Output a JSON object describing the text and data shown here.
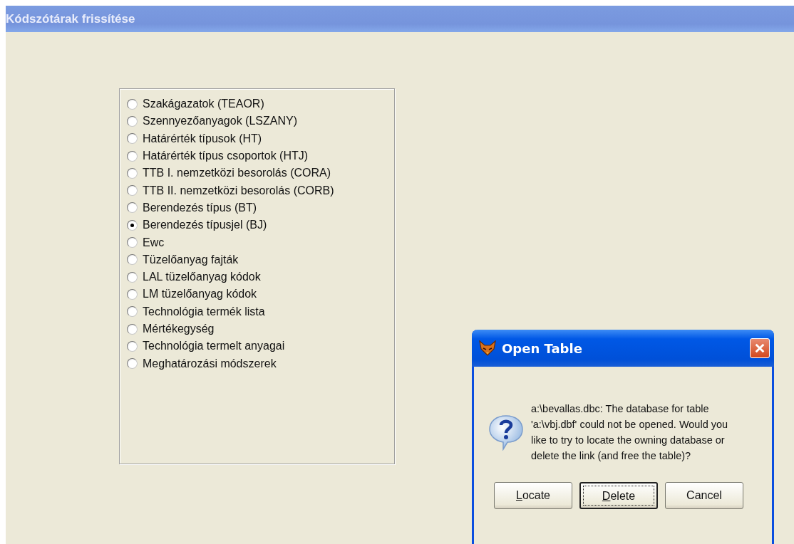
{
  "window": {
    "title": "Kódszótárak frissítése"
  },
  "options": [
    {
      "label": "Szakágazatok (TEAOR)",
      "selected": false
    },
    {
      "label": "Szennyezőanyagok (LSZANY)",
      "selected": false
    },
    {
      "label": "Határérték típusok (HT)",
      "selected": false
    },
    {
      "label": "Határérték típus csoportok (HTJ)",
      "selected": false
    },
    {
      "label": "TTB I. nemzetközi besorolás (CORA)",
      "selected": false
    },
    {
      "label": "TTB II. nemzetközi besorolás (CORB)",
      "selected": false
    },
    {
      "label": "Berendezés típus (BT)",
      "selected": false
    },
    {
      "label": "Berendezés típusjel (BJ)",
      "selected": true
    },
    {
      "label": "Ewc",
      "selected": false
    },
    {
      "label": "Tüzelőanyag fajták",
      "selected": false
    },
    {
      "label": "LAL tüzelőanyag kódok",
      "selected": false
    },
    {
      "label": "LM tüzelőanyag kódok",
      "selected": false
    },
    {
      "label": "Technológia termék lista",
      "selected": false
    },
    {
      "label": "Mértékegység",
      "selected": false
    },
    {
      "label": "Technológia termelt anyagai",
      "selected": false
    },
    {
      "label": "Meghatározási módszerek",
      "selected": false
    }
  ],
  "dialog": {
    "title": "Open Table",
    "message": "a:\\bevallas.dbc: The database for table 'a:\\vbj.dbf' could not be opened. Would you like to try to locate the owning database or delete the link (and free the table)?",
    "buttons": [
      {
        "label": "Locate",
        "mnemonic": true,
        "focused": false
      },
      {
        "label": "Delete",
        "mnemonic": true,
        "focused": true
      },
      {
        "label": "Cancel",
        "mnemonic": false,
        "focused": false
      }
    ]
  }
}
